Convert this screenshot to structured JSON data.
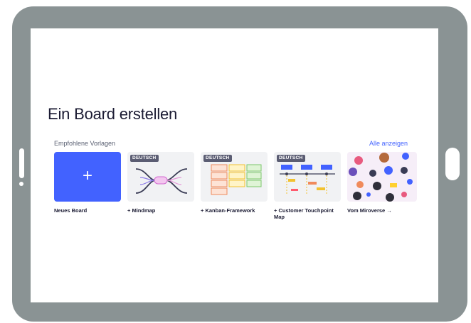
{
  "page": {
    "title": "Ein Board erstellen",
    "section_label": "Empfohlene Vorlagen",
    "show_all_label": "Alle anzeigen"
  },
  "cards": [
    {
      "label": "Neues Board",
      "icon": "plus-icon"
    },
    {
      "label": "+ Mindmap",
      "badge": "DEUTSCH"
    },
    {
      "label": "+ Kanban-Framework",
      "badge": "DEUTSCH"
    },
    {
      "label": "+ Customer Touchpoint Map",
      "badge": "DEUTSCH"
    },
    {
      "label": "Vom Miroverse →"
    }
  ],
  "plus_symbol": "+",
  "colors": {
    "accent": "#4262ff",
    "device_frame": "#8a9394",
    "text_dark": "#1b1b33"
  }
}
